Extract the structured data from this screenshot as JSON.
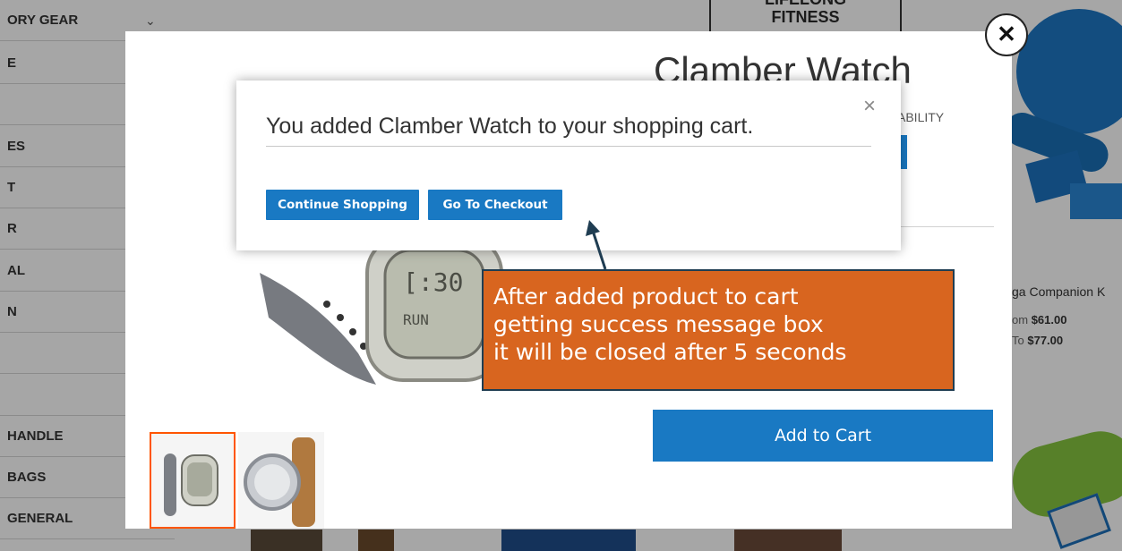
{
  "sidebar": {
    "items": [
      {
        "label": "ORY GEAR"
      },
      {
        "label": "E"
      },
      {
        "label": ""
      },
      {
        "label": "ES"
      },
      {
        "label": "T"
      },
      {
        "label": "R"
      },
      {
        "label": "AL"
      },
      {
        "label": "N"
      },
      {
        "label": ""
      },
      {
        "label": ""
      },
      {
        "label": "HANDLE"
      },
      {
        "label": "BAGS"
      },
      {
        "label": "GENERAL"
      }
    ],
    "chevron": "chevron-down-icon"
  },
  "background": {
    "book_title_line1": "LIFELONG",
    "book_title_line2": "FITNESS",
    "product_name": "ga Companion K",
    "price_from_label": "om",
    "price_from": "$61.00",
    "price_to_label": "To",
    "price_to": "$77.00"
  },
  "quickview": {
    "title": "Clamber Watch",
    "stock": "ABILITY",
    "add_to_cart_label": "Add to Cart",
    "close_icon": "close-icon"
  },
  "success": {
    "message": "You added Clamber Watch to your shopping cart.",
    "close_glyph": "×",
    "continue_label": "Continue Shopping",
    "checkout_label": "Go To Checkout"
  },
  "annotation": {
    "lines": [
      "After added product to cart",
      "getting success message box",
      "it will be closed after 5 seconds"
    ]
  },
  "colors": {
    "button_blue": "#1979c3",
    "callout_orange": "#d8651f",
    "callout_border": "#1f3d52",
    "thumb_active_border": "#ff5501"
  }
}
